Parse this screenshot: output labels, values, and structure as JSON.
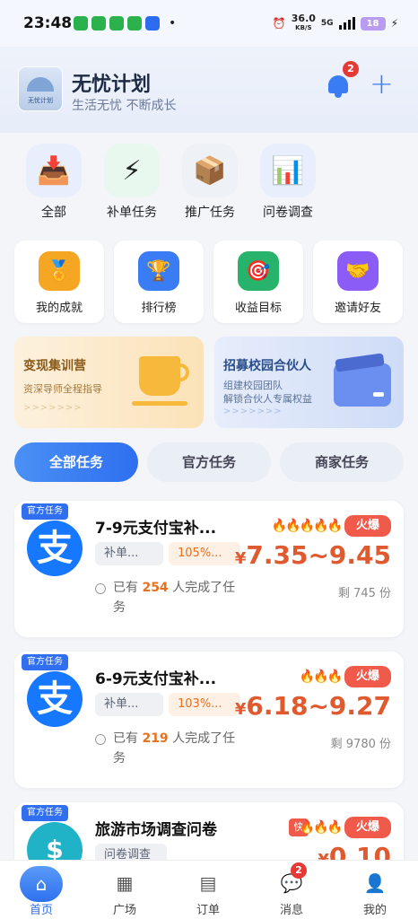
{
  "status_bar": {
    "time": "23:48",
    "speed": "36.0",
    "speed_unit": "KB/S",
    "network": "5G",
    "battery": "18"
  },
  "header": {
    "title": "无忧计划",
    "subtitle": "生活无忧 不断成长",
    "logo_text": "无忧计划",
    "notif_count": "2",
    "add_icon": "+"
  },
  "categories": [
    {
      "label": "全部",
      "icon": "inbox-icon"
    },
    {
      "label": "补单任务",
      "icon": "lightning-icon"
    },
    {
      "label": "推广任务",
      "icon": "box-icon"
    },
    {
      "label": "问卷调查",
      "icon": "chart-icon"
    }
  ],
  "features": [
    {
      "label": "我的成就",
      "icon": "medal-icon",
      "color": "#f5a623"
    },
    {
      "label": "排行榜",
      "icon": "trophy-icon",
      "color": "#3a7cf4"
    },
    {
      "label": "收益目标",
      "icon": "target-icon",
      "color": "#27b36b"
    },
    {
      "label": "邀请好友",
      "icon": "handshake-icon",
      "color": "#8b5cf6"
    }
  ],
  "banners": [
    {
      "title": "变现集训营",
      "subtitle": "资深导师全程指导",
      "arrows": ">>>>>>>"
    },
    {
      "title": "招募校园合伙人",
      "subtitle_1": "组建校园团队",
      "subtitle_2": "解锁合伙人专属权益",
      "arrows": ">>>>>>>"
    }
  ],
  "filter_tabs": [
    {
      "label": "全部任务",
      "active": true
    },
    {
      "label": "官方任务",
      "active": false
    },
    {
      "label": "商家任务",
      "active": false
    }
  ],
  "tasks": [
    {
      "tag": "官方任务",
      "icon_char": "支",
      "title": "7-9元支付宝补...",
      "chip1": "补单...",
      "chip2": "105%...",
      "done_prefix": "已有",
      "done_count": "254",
      "done_suffix": "人完成了任务",
      "fires": "🔥🔥🔥🔥🔥",
      "hot": "火爆",
      "currency": "¥",
      "price": "7.35~9.45",
      "remain": "剩 745 份"
    },
    {
      "tag": "官方任务",
      "icon_char": "支",
      "title": "6-9元支付宝补...",
      "chip1": "补单...",
      "chip2": "103%...",
      "done_prefix": "已有",
      "done_count": "219",
      "done_suffix": "人完成了任务",
      "fires": "🔥🔥🔥",
      "hot": "火爆",
      "currency": "¥",
      "price": "6.18~9.27",
      "remain": "剩 9780 份"
    },
    {
      "tag": "官方任务",
      "icon_char": "$",
      "title": "旅游市场调查问卷",
      "chip1": "问卷调查",
      "fast": "快",
      "fires": "🔥🔥🔥",
      "hot": "火爆",
      "currency": "¥",
      "price": "0.10"
    }
  ],
  "nav": [
    {
      "label": "首页",
      "icon": "home-icon",
      "active": true
    },
    {
      "label": "广场",
      "icon": "grid-icon",
      "active": false
    },
    {
      "label": "订单",
      "icon": "order-icon",
      "active": false
    },
    {
      "label": "消息",
      "icon": "message-icon",
      "active": false,
      "badge": "2"
    },
    {
      "label": "我的",
      "icon": "user-icon",
      "active": false
    }
  ]
}
